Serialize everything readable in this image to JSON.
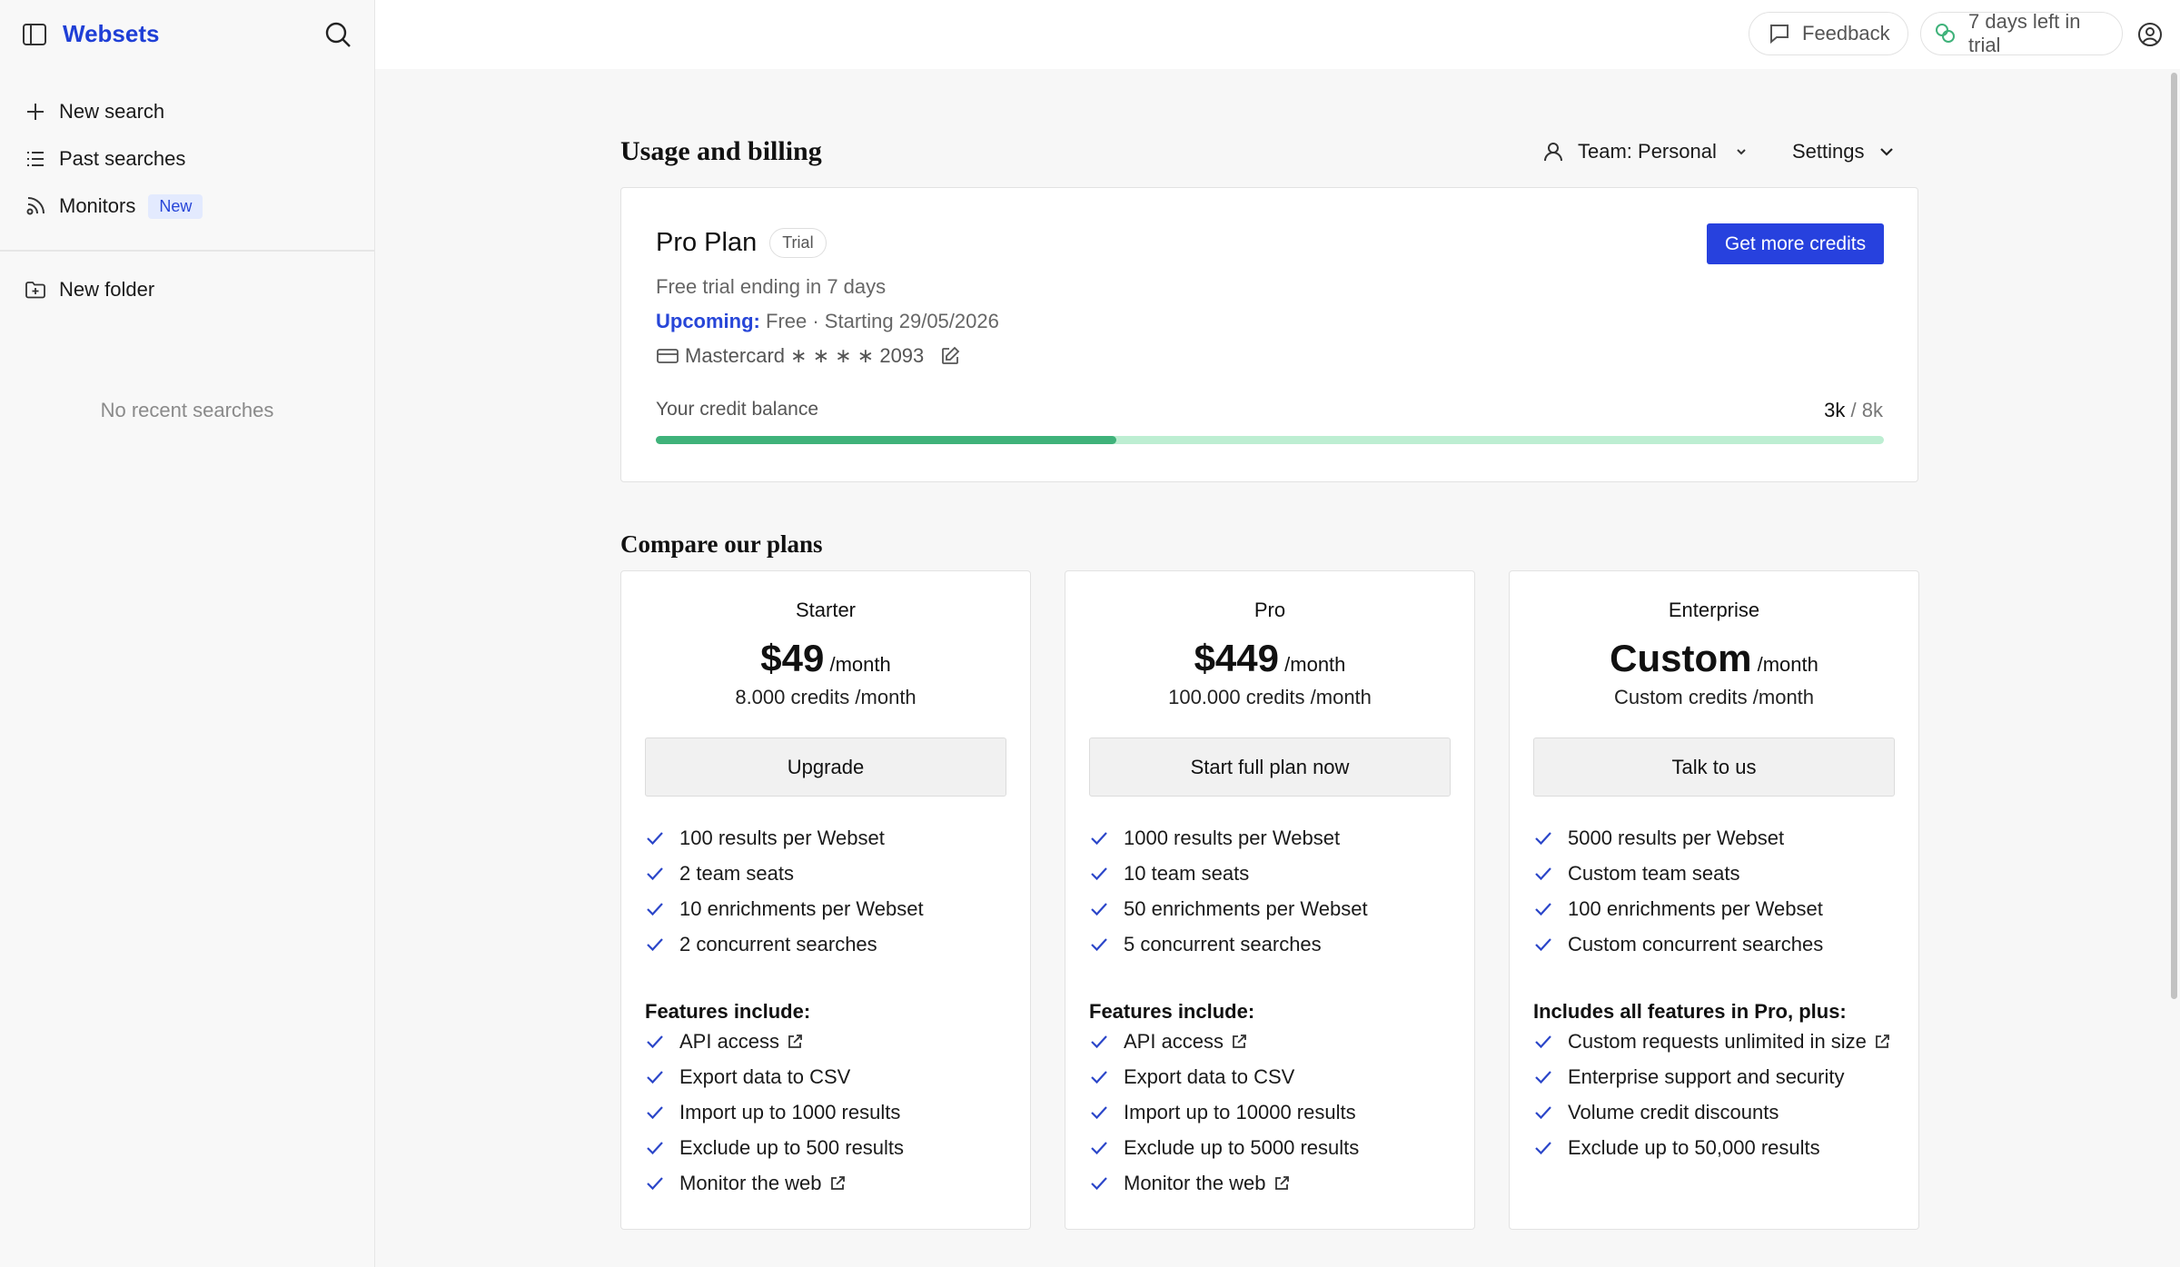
{
  "sidebar": {
    "brand": "Websets",
    "nav": [
      {
        "label": "New search"
      },
      {
        "label": "Past searches"
      },
      {
        "label": "Monitors",
        "badge": "New"
      }
    ],
    "folder_label": "New folder",
    "empty_text": "No recent searches"
  },
  "topbar": {
    "feedback_label": "Feedback",
    "trial_label": "7 days left in trial"
  },
  "usage": {
    "heading": "Usage and billing",
    "team_label": "Team: Personal",
    "settings_label": "Settings"
  },
  "plan": {
    "name": "Pro Plan",
    "badge": "Trial",
    "subtitle": "Free trial ending in 7 days",
    "upcoming_label": "Upcoming:",
    "upcoming_value": "Free · Starting 29/05/2026",
    "card_text": "Mastercard ∗ ∗ ∗ ∗ 2093",
    "cta_label": "Get more credits",
    "balance_label": "Your credit balance",
    "balance_used": "3k",
    "balance_sep": "/",
    "balance_total": "8k",
    "balance_fraction": 0.375
  },
  "compare": {
    "heading": "Compare our plans",
    "tiers": [
      {
        "name": "Starter",
        "price": "$49",
        "period": "/month",
        "credits": "8.000 credits /month",
        "cta": "Upgrade",
        "limits": [
          "100 results per Webset",
          "2 team seats",
          "10 enrichments per Webset",
          "2 concurrent searches"
        ],
        "features_heading": "Features include:",
        "features": [
          "API access",
          "Export data to CSV",
          "Import up to 1000 results",
          "Exclude up to 500 results",
          "Monitor the web"
        ]
      },
      {
        "name": "Pro",
        "price": "$449",
        "period": "/month",
        "credits": "100.000 credits /month",
        "cta": "Start full plan now",
        "limits": [
          "1000 results per Webset",
          "10 team seats",
          "50 enrichments per Webset",
          "5 concurrent searches"
        ],
        "features_heading": "Features include:",
        "features": [
          "API access",
          "Export data to CSV",
          "Import up to 10000 results",
          "Exclude up to 5000 results",
          "Monitor the web"
        ]
      },
      {
        "name": "Enterprise",
        "price": "Custom",
        "period": "/month",
        "credits": "Custom credits /month",
        "cta": "Talk to us",
        "limits": [
          "5000 results per Webset",
          "Custom team seats",
          "100 enrichments per Webset",
          "Custom concurrent searches"
        ],
        "features_heading": "Includes all features in Pro, plus:",
        "features": [
          "Custom requests unlimited in size",
          "Enterprise support and security",
          "Volume credit discounts",
          "Exclude up to 50,000 results"
        ]
      }
    ]
  },
  "colors": {
    "accent": "#2741de",
    "progress_fill": "#3fb27a",
    "progress_track": "#bdeed2"
  }
}
